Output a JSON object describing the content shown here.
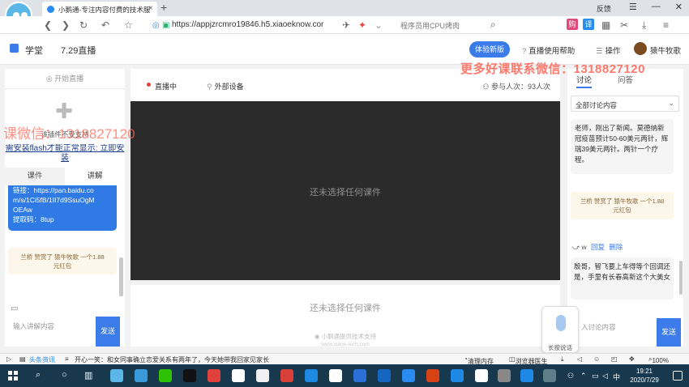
{
  "browser": {
    "tab_title": "小鹅通-专注内容付费的技术服",
    "tab_close": "×",
    "new_tab": "+",
    "address_main": "https://appjzrcmro19846.h5",
    "address_domain": ".xiaoeknow.cor",
    "address_hint": "程序员用CPU烤肉",
    "feedback": "反馈",
    "minimize": "—",
    "close": "✕"
  },
  "app": {
    "brand": "学堂",
    "course_title": "7.29直播",
    "new_version_btn": "体验新版",
    "help_link": "直播使用帮助",
    "operate_link": "操作",
    "username": "猿牛牧歌"
  },
  "watermarks": {
    "top": "更多好课联系微信：1318827120",
    "left": "课微信：1318827120"
  },
  "left": {
    "start_live": "开始直播",
    "plugin_unsupported": "该插件不受支持",
    "flash_link": "需安装flash才能正常显示: 立即安装",
    "tabs": [
      "课件",
      "讲解"
    ],
    "msg_blue_lines": [
      "链接：https://pan.baidu.co",
      "m/s/1Ci5fB/1II7d9SsuOgM",
      "OEAw",
      "提取码：8tup"
    ],
    "tip_line1": "兰桥 赞赏了 猿牛牧歌 一个1.88",
    "tip_line2": "元红包",
    "input_placeholder": "输入讲解内容",
    "send": "发送"
  },
  "center": {
    "live_status": "直播中",
    "external_device": "外部设备",
    "viewers": "参与人次：93人次",
    "stage_message": "还未选择任何课件",
    "sub_message": "还未选择任何课件",
    "powered_by": "小鹅通提供技术支持",
    "powered_url": "www.xiaoe-tech.com"
  },
  "right": {
    "tabs": [
      "讨论",
      "问答"
    ],
    "filter": "全部讨论内容",
    "msg1": "老师，刚出了新闻。莫德纳新冠疫苗预计50-60美元两针，辉瑞39美元两针。两针一个疗程。",
    "tip_line1": "兰桥 赞赏了 猿牛牧歌 一个1.88",
    "tip_line2": "元红包",
    "reply_user": "w",
    "reply_link": "回复",
    "delete_link": "删除",
    "msg2": "殷哥，智飞要上车得等个回调还是，手里有长春高新这个大美女",
    "input_placeholder": "入讨论内容",
    "send": "发送",
    "voice_label": "长按说话"
  },
  "statusbar": {
    "news": "头条资讯",
    "headline": "开心一笑：和女同事确立恋爱关系有两年了，今天她带我回家见家长",
    "clean": "清理内存",
    "doctor": "浏览器医生",
    "zoom": "100%"
  },
  "taskbar": {
    "time": "19:21",
    "date": "2020/7/29",
    "ime": "中"
  },
  "colors": {
    "accent": "#3b7bea",
    "live_dot": "#e0413a",
    "watermark": "#ff5a4a",
    "taskbar": "#18384e"
  }
}
